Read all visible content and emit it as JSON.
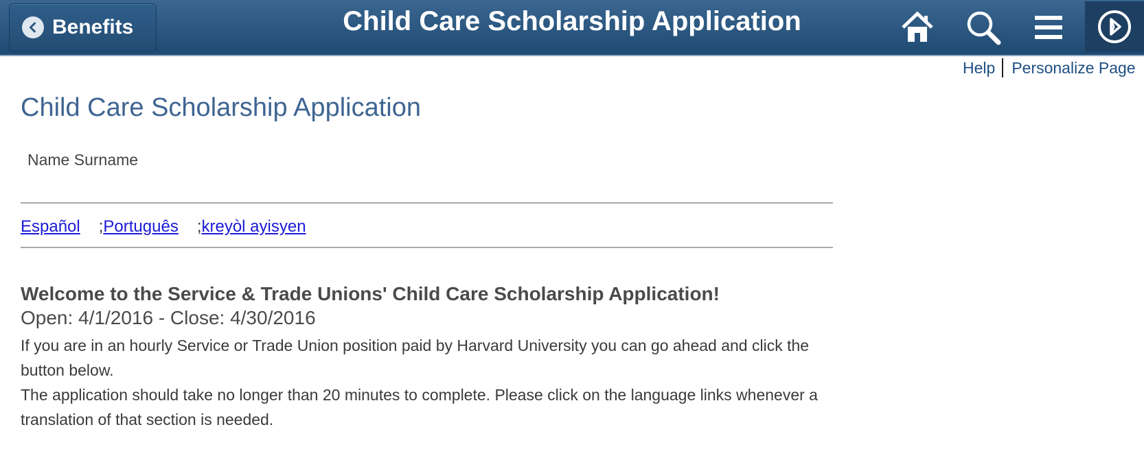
{
  "header": {
    "back_label": "Benefits",
    "title": "Child Care Scholarship Application",
    "icons": [
      "home-icon",
      "search-icon",
      "menu-icon",
      "navbar-icon"
    ],
    "bar_color": "#2b5680"
  },
  "help": {
    "help_label": "Help",
    "personalize_label": "Personalize Page"
  },
  "main": {
    "page_title": "Child Care Scholarship Application",
    "user_name": "Name Surname",
    "languages": [
      {
        "label": "Español",
        "prefix": ""
      },
      {
        "label": "Português",
        "prefix": ";"
      },
      {
        "label": "kreyòl ayisyen",
        "prefix": ";"
      }
    ],
    "welcome": "Welcome to the Service & Trade Unions' Child Care Scholarship Application!",
    "dates": "Open: 4/1/2016 - Close: 4/30/2016",
    "para1": "If you are in an hourly Service or Trade Union position paid by Harvard University you can go ahead and click the button below.",
    "para2": "The application should take no longer than 20 minutes to complete. Please click on the language links whenever a translation of that section is needed."
  }
}
